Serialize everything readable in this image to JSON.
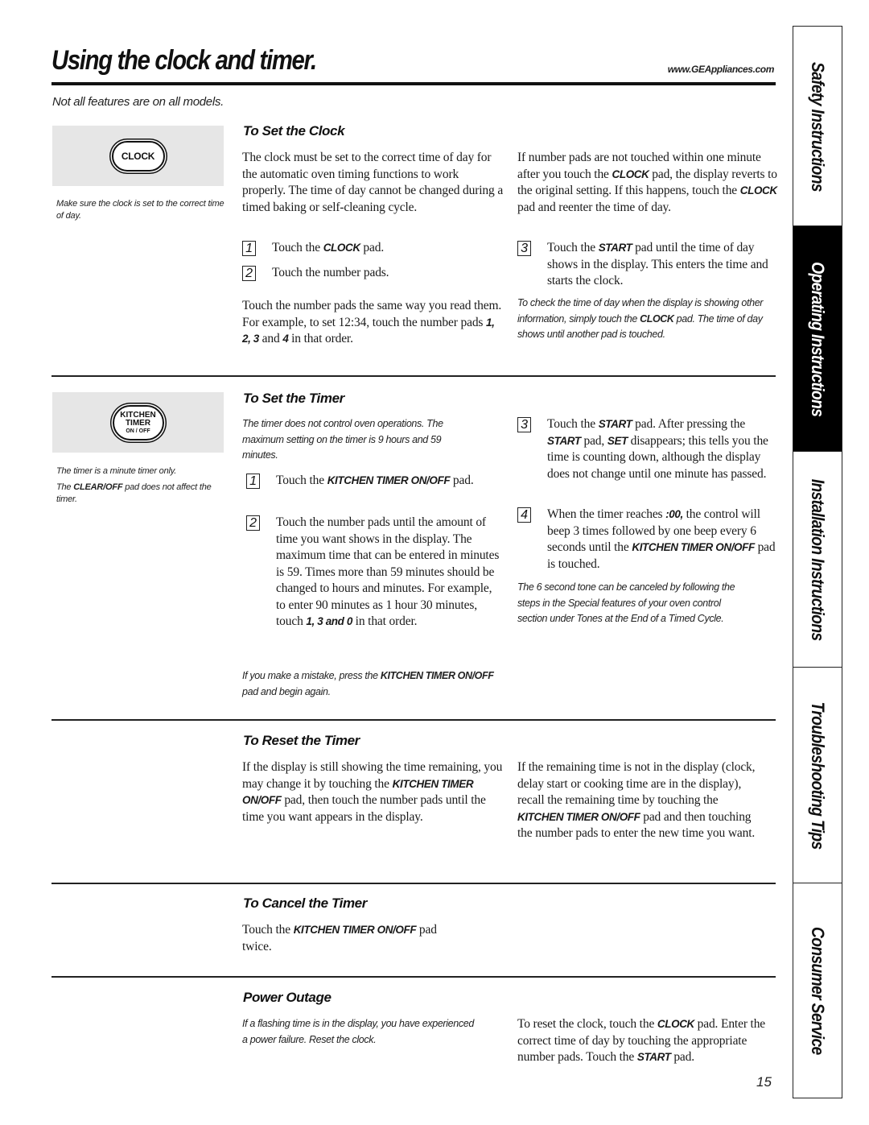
{
  "header": {
    "title": "Using the clock and timer.",
    "url": "www.GEAppliances.com",
    "subtitle": "Not all features are on all models."
  },
  "sidebar_tabs": [
    {
      "label": "Safety Instructions",
      "active": false
    },
    {
      "label": "Operating Instructions",
      "active": true
    },
    {
      "label": "Installation Instructions",
      "active": false
    },
    {
      "label": "Troubleshooting Tips",
      "active": false
    },
    {
      "label": "Consumer Service",
      "active": false
    }
  ],
  "clock_section": {
    "pad_label": "CLOCK",
    "side_note": "Make sure the clock is set to the correct time of day.",
    "heading": "To Set the Clock",
    "intro": "The clock must be set to the correct time of day for the automatic oven timing functions to work properly. The time of day cannot be changed during a timed baking or self-cleaning cycle.",
    "steps": [
      {
        "num": "1",
        "pre": "Touch the ",
        "bold": "CLOCK",
        "post": " pad."
      },
      {
        "num": "2",
        "pre": "Touch the number pads.",
        "bold": "",
        "post": ""
      },
      {
        "num": "3",
        "pre": "Touch the ",
        "bold": "START",
        "post": " pad until the time of day shows in the display. This enters the time and starts the clock."
      }
    ],
    "example": {
      "pre": "Touch the number pads the same way you read them. For example, to set 12:34, touch the number pads ",
      "bold1": "1, 2, 3",
      "mid": " and ",
      "bold2": "4",
      "post": " in that order."
    },
    "revert_note": {
      "p1": "If number pads are not touched within one minute after you touch the ",
      "b1": "CLOCK",
      "p2": " pad, the display reverts to the original setting. If this happens, touch the ",
      "b2": "CLOCK",
      "p3": " pad and reenter the time of day."
    },
    "check_note": {
      "pre": "To check the time of day when the display is showing other information, simply touch the ",
      "bold": "CLOCK",
      "post": " pad. The time of day shows until another pad is touched."
    }
  },
  "timer_section": {
    "pad_label_lines": [
      "KITCHEN",
      "TIMER",
      "ON / OFF"
    ],
    "side_note_1": "The timer is a minute timer only.",
    "side_note_2": {
      "pre": "The ",
      "bold": "CLEAR/OFF",
      "post": " pad does not affect the timer."
    },
    "heading": "To Set the Timer",
    "intro_note": "The timer does not control oven operations. The maximum setting on the timer is 9 hours and 59 minutes.",
    "steps": [
      {
        "num": "1",
        "pre": "Touch the ",
        "bold": "KITCHEN TIMER ON/OFF",
        "post": " pad."
      },
      {
        "num": "2",
        "pre": "Touch the number pads until the amount of time you want shows in the display. The maximum time that can be entered in minutes is 59. Times more than 59 minutes should be changed to hours and minutes. For example, to enter 90 minutes as 1 hour 30 minutes, touch ",
        "bold": "1, 3 and 0",
        "post": " in that order."
      },
      {
        "num": "3",
        "p1": "Touch the ",
        "b1": "START",
        "p2": " pad. After pressing the ",
        "b2": "START",
        "p3": " pad, ",
        "b3": "SET",
        "p4": " disappears; this tells you the time is counting down, although the display does not change until one minute has passed."
      },
      {
        "num": "4",
        "p1": "When the timer reaches ",
        "b1": ":00,",
        "p2": " the control will beep 3 times followed by one beep every 6 seconds until the ",
        "b2": "KITCHEN TIMER ON/OFF",
        "p3": " pad is touched."
      }
    ],
    "mistake_note": {
      "pre": "If you make a mistake, press the ",
      "bold": "KITCHEN TIMER ON/OFF",
      "post": " pad and begin again."
    },
    "tone_note": "The 6 second tone can be canceled by following the steps in the Special features of your oven control section under Tones at the End of a Timed Cycle."
  },
  "reset_section": {
    "heading": "To Reset the Timer",
    "left": {
      "pre": "If the display is still showing the time remaining, you may change it by touching the ",
      "bold": "KITCHEN TIMER ON/OFF",
      "post": " pad, then touch the number pads until the time you want appears in the display."
    },
    "right": {
      "pre": "If the remaining time is not in the display (clock, delay start or cooking time are in the display), recall the remaining time by touching the ",
      "bold": "KITCHEN TIMER ON/OFF",
      "post": " pad and then touching the number pads to enter the new time you want."
    }
  },
  "cancel_section": {
    "heading": "To Cancel the Timer",
    "text": {
      "pre": "Touch the ",
      "bold": "KITCHEN TIMER ON/OFF",
      "post": " pad twice."
    }
  },
  "power_section": {
    "heading": "Power Outage",
    "note": "If a flashing time is in the display, you have experienced a power failure. Reset the clock.",
    "right": {
      "p1": "To reset the clock, touch the ",
      "b1": "CLOCK",
      "p2": " pad. Enter the correct time of day by touching the appropriate number pads. Touch the ",
      "b2": "START",
      "p3": " pad."
    }
  },
  "page_number": "15"
}
